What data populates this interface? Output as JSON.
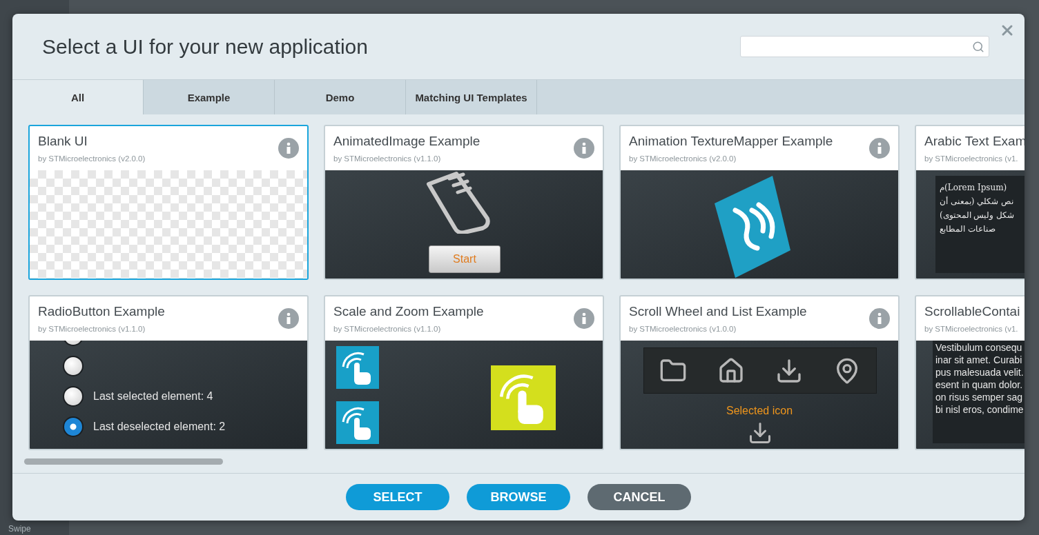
{
  "background": {
    "sidebar_label": "Swipe"
  },
  "dialog": {
    "title": "Select a UI for your new application",
    "tabs": [
      {
        "label": "All",
        "selected": true
      },
      {
        "label": "Example",
        "selected": false
      },
      {
        "label": "Demo",
        "selected": false
      },
      {
        "label": "Matching UI Templates",
        "selected": false
      }
    ],
    "cards": [
      {
        "title": "Blank UI",
        "author": "by STMicroelectronics (v2.0.0)",
        "selected": true,
        "info": true,
        "preview": {
          "kind": "blank"
        }
      },
      {
        "title": "AnimatedImage Example",
        "author": "by STMicroelectronics (v1.1.0)",
        "selected": false,
        "info": true,
        "preview": {
          "kind": "animated",
          "button": "Start"
        }
      },
      {
        "title": "Animation TextureMapper Example",
        "author": "by STMicroelectronics (v2.0.0)",
        "selected": false,
        "info": true,
        "preview": {
          "kind": "texture"
        }
      },
      {
        "title": "Arabic Text Exam",
        "author": "by STMicroelectronics (v1.",
        "selected": false,
        "preview": {
          "kind": "arabic",
          "lines": [
            "(Lorem Ipsum)م",
            "نص شكلي (بمعنى أن",
            "شكل وليس المحتوى)",
            "صناعات المطابع"
          ]
        }
      },
      {
        "title": "RadioButton Example",
        "author": "by STMicroelectronics (v1.1.0)",
        "selected": false,
        "info": true,
        "preview": {
          "kind": "radio",
          "radios": [
            {
              "selected": false
            },
            {
              "selected": false
            },
            {
              "label": "Last selected element: 4",
              "selected": false
            },
            {
              "label": "Last deselected element: 2",
              "selected": true
            }
          ]
        }
      },
      {
        "title": "Scale and Zoom Example",
        "author": "by STMicroelectronics (v1.1.0)",
        "selected": false,
        "info": true,
        "preview": {
          "kind": "scale"
        }
      },
      {
        "title": "Scroll Wheel and List Example",
        "author": "by STMicroelectronics (v1.0.0)",
        "selected": false,
        "info": true,
        "preview": {
          "kind": "wheel",
          "caption": "Selected icon"
        }
      },
      {
        "title": "ScrollableContai",
        "author": "by STMicroelectronics (v1.",
        "selected": false,
        "preview": {
          "kind": "lorem",
          "lines": [
            "Vestibulum consequ",
            "inar sit amet. Curabi",
            "pus malesuada velit.",
            "esent in quam dolor.",
            "on risus semper sag",
            "bi nisl eros, condime"
          ]
        }
      }
    ],
    "buttons": [
      {
        "label": "SELECT",
        "kind": "primary"
      },
      {
        "label": "BROWSE",
        "kind": "primary"
      },
      {
        "label": "CANCEL",
        "kind": "secondary"
      }
    ]
  }
}
